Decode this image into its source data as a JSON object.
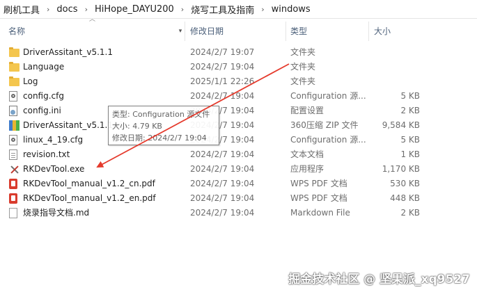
{
  "breadcrumb": {
    "items": [
      "刷机工具",
      "docs",
      "HiHope_DAYU200",
      "烧写工具及指南",
      "windows"
    ],
    "separator": "›"
  },
  "columns": {
    "name": "名称",
    "date": "修改日期",
    "type": "类型",
    "size": "大小"
  },
  "files": [
    {
      "icon": "folder-icon",
      "name": "DriverAssitant_v5.1.1",
      "date": "2024/2/7 19:07",
      "type": "文件夹",
      "size": ""
    },
    {
      "icon": "folder-icon",
      "name": "Language",
      "date": "2024/2/7 19:04",
      "type": "文件夹",
      "size": ""
    },
    {
      "icon": "folder-icon",
      "name": "Log",
      "date": "2025/1/1 22:26",
      "type": "文件夹",
      "size": ""
    },
    {
      "icon": "gear-file-icon",
      "name": "config.cfg",
      "date": "2024/2/7 19:04",
      "type": "Configuration 源...",
      "size": "5 KB"
    },
    {
      "icon": "ini-file-icon",
      "name": "config.ini",
      "date": "2024/2/7 19:04",
      "type": "配置设置",
      "size": "2 KB"
    },
    {
      "icon": "zip-icon",
      "name": "DriverAssitant_v5.1.1.zip",
      "date": "2024/2/7 19:04",
      "type": "360压缩 ZIP 文件",
      "size": "9,584 KB"
    },
    {
      "icon": "gear-file-icon",
      "name": "linux_4_19.cfg",
      "date": "2024/2/7 19:04",
      "type": "Configuration 源...",
      "size": "5 KB"
    },
    {
      "icon": "text-file-icon",
      "name": "revision.txt",
      "date": "2024/2/7 19:04",
      "type": "文本文档",
      "size": "1 KB"
    },
    {
      "icon": "exe-icon",
      "name": "RKDevTool.exe",
      "date": "2024/2/7 19:04",
      "type": "应用程序",
      "size": "1,170 KB"
    },
    {
      "icon": "pdf-icon",
      "name": "RKDevTool_manual_v1.2_cn.pdf",
      "date": "2024/2/7 19:04",
      "type": "WPS PDF 文档",
      "size": "530 KB"
    },
    {
      "icon": "pdf-icon",
      "name": "RKDevTool_manual_v1.2_en.pdf",
      "date": "2024/2/7 19:04",
      "type": "WPS PDF 文档",
      "size": "448 KB"
    },
    {
      "icon": "md-file-icon",
      "name": "烧录指导文档.md",
      "date": "2024/2/7 19:04",
      "type": "Markdown File",
      "size": "2 KB"
    }
  ],
  "tooltip": {
    "type_line": "类型: Configuration 源文件",
    "size_line": "大小: 4.79 KB",
    "date_line": "修改日期: 2024/2/7 19:04"
  },
  "watermark": "掘金技术社区 @ 坚果派_xq9527",
  "colors": {
    "annotation_arrow": "#e53a2c",
    "header_text": "#4c607a",
    "folder": "#f4c64e"
  }
}
